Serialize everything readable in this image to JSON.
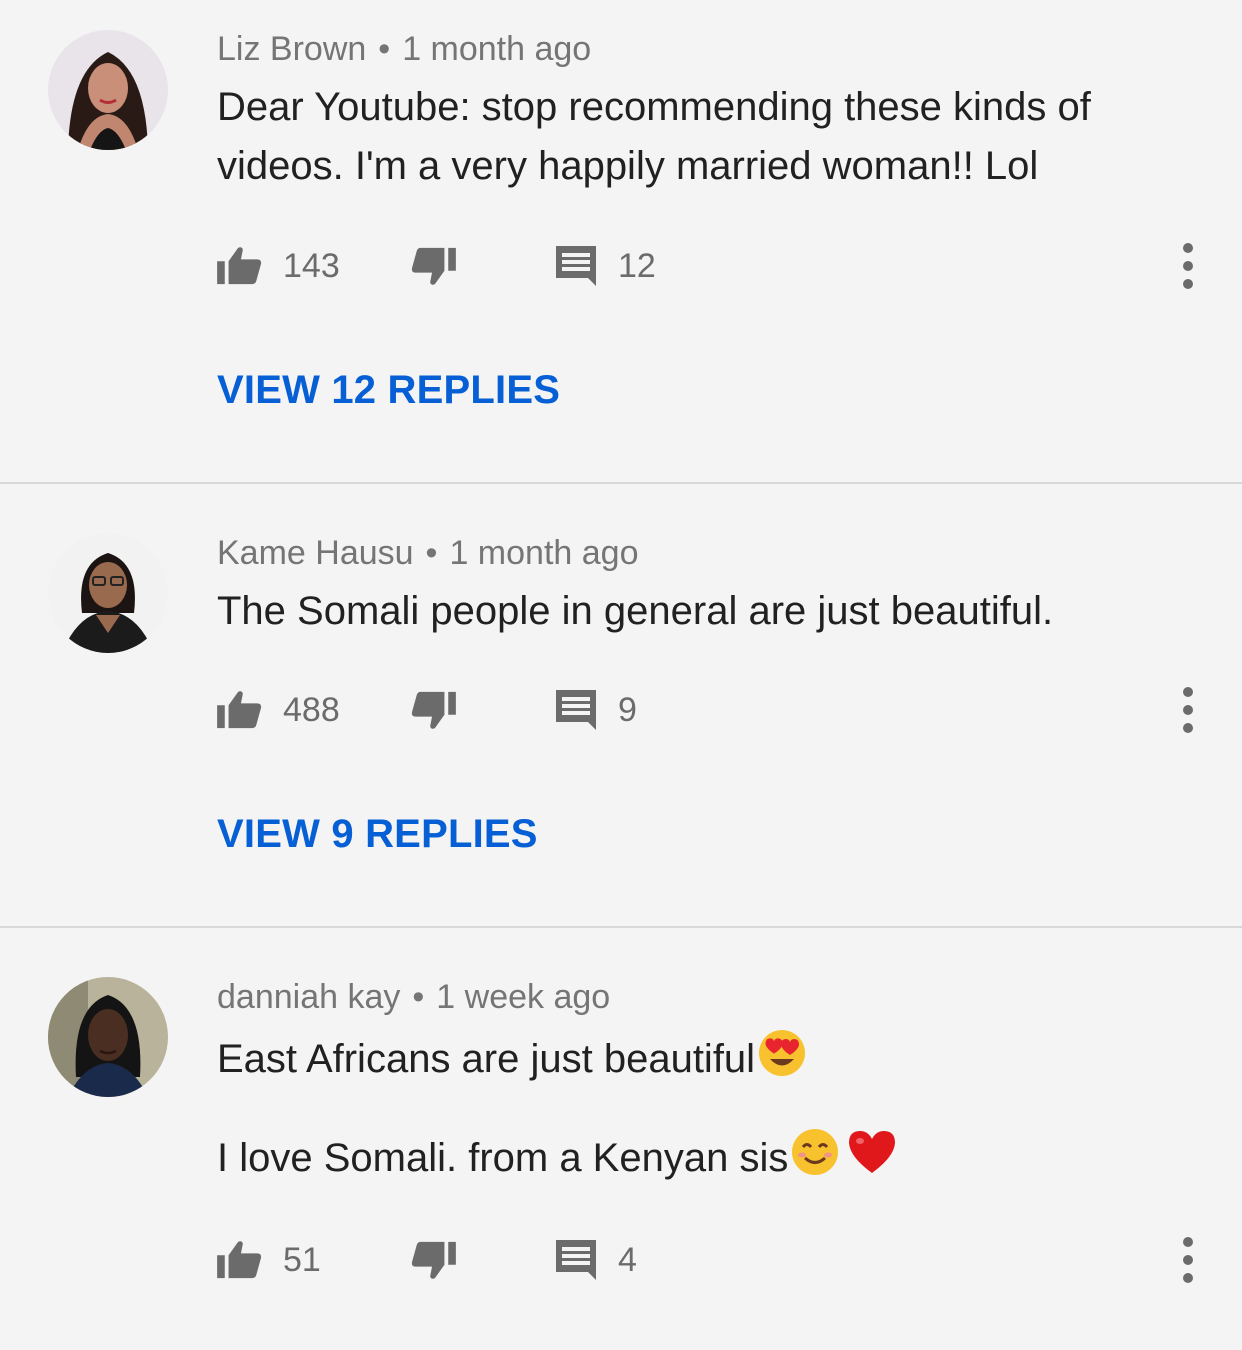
{
  "comments": [
    {
      "author": "Liz Brown",
      "time": "1 month ago",
      "lines": [
        "Dear Youtube: stop  recommending  these kinds of",
        "videos. I'm a very happily married woman!! Lol"
      ],
      "likes": "143",
      "replies_count": "12",
      "view_replies": "VIEW 12 REPLIES"
    },
    {
      "author": "Kame Hausu",
      "time": "1 month ago",
      "lines": [
        "The Somali people in general are just beautiful."
      ],
      "likes": "488",
      "replies_count": "9",
      "view_replies": "VIEW 9 REPLIES"
    },
    {
      "author": "danniah kay",
      "time": "1 week ago",
      "lines": [
        "East Africans are just beautiful",
        "I love Somali. from a Kenyan sis"
      ],
      "likes": "51",
      "replies_count": "4"
    }
  ],
  "meta_separator": "•",
  "colors": {
    "link": "#065fd4",
    "meta": "#757575",
    "background": "#f4f4f4"
  },
  "icons": [
    "thumbs-up-icon",
    "thumbs-down-icon",
    "reply-icon",
    "more-vert-icon",
    "heart-eyes-emoji",
    "smile-emoji",
    "red-heart-emoji"
  ]
}
